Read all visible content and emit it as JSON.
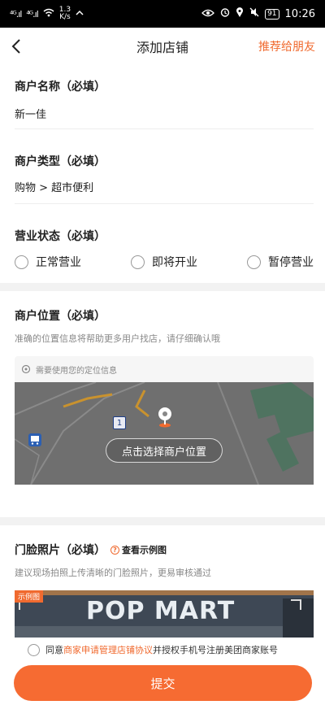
{
  "status_bar": {
    "signal1": "⁴ᴳ.ıl",
    "signal2": "⁴ᴳ.ıl",
    "speed_value": "1.3",
    "speed_unit": "K/s",
    "battery": "91",
    "time": "10:26"
  },
  "navbar": {
    "title": "添加店铺",
    "recommend_label": "推荐给朋友"
  },
  "form": {
    "name": {
      "label": "商户名称（必填）",
      "value": "新一佳"
    },
    "type": {
      "label": "商户类型（必填）",
      "value": "购物 > 超市便利"
    },
    "status": {
      "label": "营业状态（必填）",
      "options": [
        "正常营业",
        "即将开业",
        "暂停营业"
      ]
    },
    "location": {
      "label": "商户位置（必填）",
      "hint": "准确的位置信息将帮助更多用户找店，请仔细确认哦",
      "tip": "需要使用您的定位信息",
      "pick_button": "点击选择商户位置",
      "map_marker_number": "1"
    },
    "photo": {
      "label": "门脸照片（必填）",
      "example_link": "查看示例图",
      "hint": "建议现场拍照上传清晰的门脸照片，更易审核通过",
      "example_tag": "示例图",
      "example_brand": "POP MART"
    }
  },
  "agreement": {
    "prefix": "同意",
    "link": "商家申请管理店铺协议",
    "suffix": "并授权手机号注册美团商家账号"
  },
  "submit_label": "提交",
  "colors": {
    "accent": "#f06a2f",
    "submit": "#f66b32",
    "map": "#6e6e6e"
  }
}
